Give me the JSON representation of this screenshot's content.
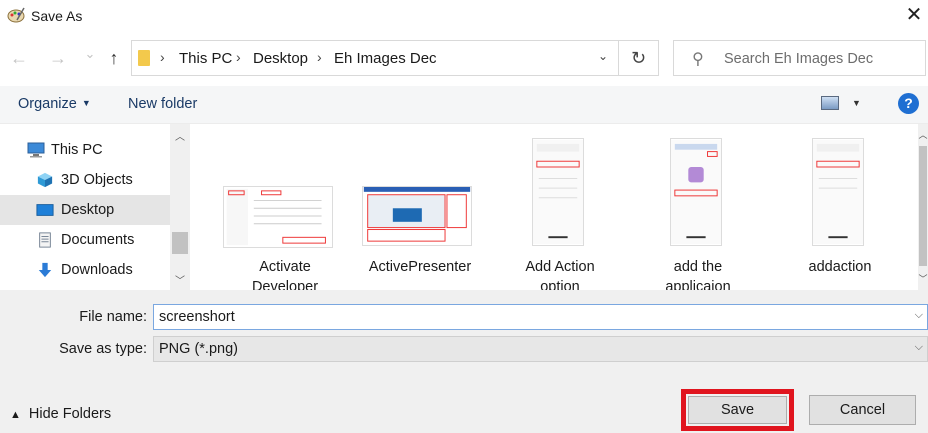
{
  "window": {
    "title": "Save As",
    "close_glyph": "✕"
  },
  "nav": {
    "back_glyph": "←",
    "forward_glyph": "→",
    "recent_glyph": "⌄",
    "up_glyph": "↑",
    "breadcrumb": [
      "This PC",
      "Desktop",
      "Eh Images Dec"
    ],
    "breadcrumb_sep": "›",
    "dropdown_glyph": "⌄",
    "refresh_glyph": "↻",
    "search_placeholder": "Search Eh Images Dec"
  },
  "toolbar": {
    "organize_label": "Organize",
    "new_folder_label": "New folder",
    "help_glyph": "?"
  },
  "sidebar": {
    "items": [
      {
        "label": "This PC",
        "icon": "computer-icon"
      },
      {
        "label": "3D Objects",
        "icon": "cube-icon"
      },
      {
        "label": "Desktop",
        "icon": "desktop-icon",
        "selected": true
      },
      {
        "label": "Documents",
        "icon": "document-icon"
      },
      {
        "label": "Downloads",
        "icon": "download-icon"
      }
    ]
  },
  "files": [
    {
      "line1": "Activate",
      "line2": "Developer"
    },
    {
      "line1": "ActivePresenter",
      "line2": ""
    },
    {
      "line1": "Add Action",
      "line2": "option"
    },
    {
      "line1": "add the",
      "line2": "applicaion"
    },
    {
      "line1": "addaction",
      "line2": ""
    }
  ],
  "form": {
    "file_name_label": "File name:",
    "file_name_value": "screenshort",
    "save_type_label": "Save as type:",
    "save_type_value": "PNG (*.png)"
  },
  "footer": {
    "hide_folders_label": "Hide Folders",
    "save_label": "Save",
    "cancel_label": "Cancel"
  },
  "colors": {
    "highlight": "#e0141e",
    "accent": "#1f6fd2"
  }
}
